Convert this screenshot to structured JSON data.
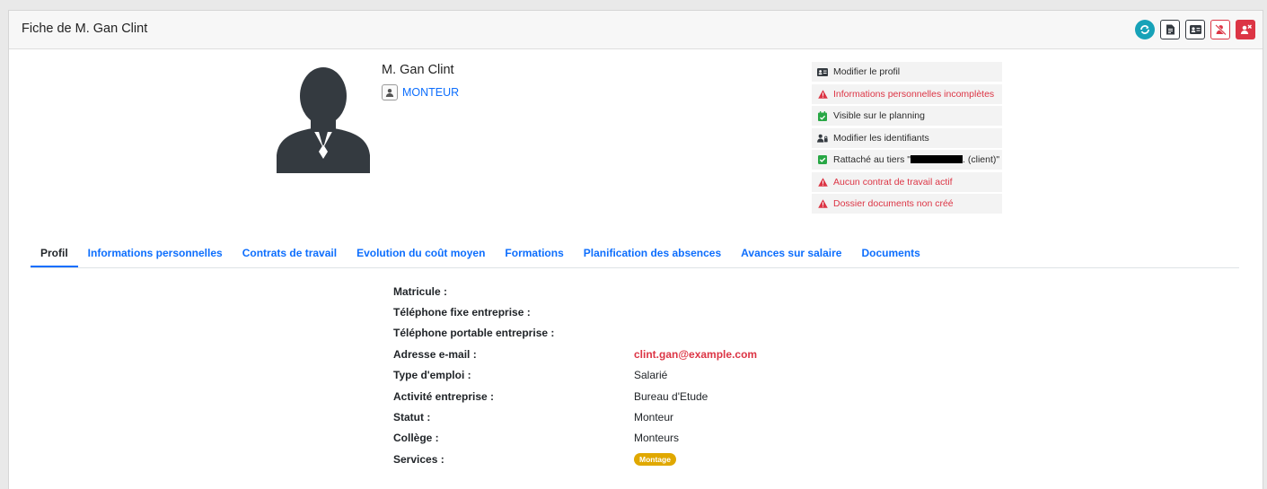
{
  "header": {
    "title": "Fiche de M. Gan Clint",
    "buttons": [
      {
        "name": "refresh-icon",
        "color": "#17a2b8"
      },
      {
        "name": "document-icon",
        "color": "#343a40"
      },
      {
        "name": "id-card-icon",
        "color": "#343a40"
      },
      {
        "name": "user-slash-icon",
        "color": "#dc3545"
      },
      {
        "name": "delete-user-icon",
        "color": "#dc3545"
      }
    ]
  },
  "employee": {
    "name": "M. Gan Clint",
    "role": "MONTEUR",
    "role_icon": "user-badge-icon"
  },
  "actions": [
    {
      "label": "Modifier le profil",
      "icon": "id-card-icon",
      "type": "default"
    },
    {
      "label": "Informations personnelles incomplètes",
      "icon": "warning-icon",
      "type": "danger"
    },
    {
      "label": "Visible sur le planning",
      "icon": "calendar-check-icon",
      "type": "success"
    },
    {
      "label": "Modifier les identifiants",
      "icon": "users-key-icon",
      "type": "default"
    },
    {
      "label_prefix": "Rattaché au tiers \"",
      "label_suffix": ". (client)\"",
      "icon": "checkbox-icon",
      "type": "success"
    },
    {
      "label": "Aucun contrat de travail actif",
      "icon": "warning-icon",
      "type": "danger"
    },
    {
      "label": "Dossier documents non créé",
      "icon": "warning-icon",
      "type": "danger"
    }
  ],
  "tabs": [
    {
      "label": "Profil",
      "active": true
    },
    {
      "label": "Informations personnelles"
    },
    {
      "label": "Contrats de travail"
    },
    {
      "label": "Evolution du coût moyen"
    },
    {
      "label": "Formations"
    },
    {
      "label": "Planification des absences"
    },
    {
      "label": "Avances sur salaire"
    },
    {
      "label": "Documents"
    }
  ],
  "profile": {
    "rows": [
      {
        "label": "Matricule :",
        "value": ""
      },
      {
        "label": "Téléphone fixe entreprise :",
        "value": ""
      },
      {
        "label": "Téléphone portable entreprise :",
        "value": ""
      },
      {
        "label": "Adresse e-mail :",
        "value": "clint.gan@example.com"
      },
      {
        "label": "Type d'emploi :",
        "value": "Salarié"
      },
      {
        "label": "Activité entreprise :",
        "value": "Bureau d'Etude"
      },
      {
        "label": "Statut :",
        "value": "Monteur"
      },
      {
        "label": "Collège :",
        "value": "Monteurs"
      },
      {
        "label": "Services :",
        "badge": "Montage"
      }
    ]
  },
  "colors": {
    "primary": "#0d6efd",
    "danger": "#dc3545",
    "success": "#28a745",
    "info": "#17a2b8",
    "warning": "#e0a800",
    "avatar": "#343a40"
  }
}
